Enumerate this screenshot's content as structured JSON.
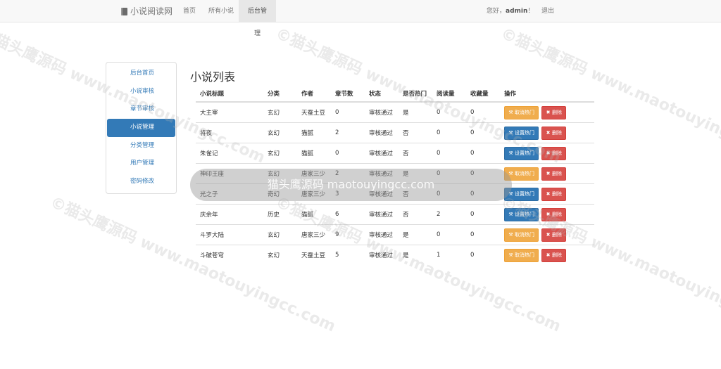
{
  "brand": {
    "title": "小说阅读网",
    "icon": "book-icon"
  },
  "nav": {
    "items": [
      {
        "label": "首页"
      },
      {
        "label": "所有小说"
      },
      {
        "label": "后台管理",
        "active": true
      }
    ],
    "greeting_prefix": "您好，",
    "username": "admin",
    "greeting_suffix": "！",
    "logout": "退出"
  },
  "sidebar": {
    "items": [
      {
        "label": "后台首页"
      },
      {
        "label": "小说审核"
      },
      {
        "label": "章节审核"
      },
      {
        "label": "小说管理",
        "active": true
      },
      {
        "label": "分类管理"
      },
      {
        "label": "用户管理"
      },
      {
        "label": "密码修改"
      }
    ]
  },
  "page": {
    "title": "小说列表"
  },
  "table": {
    "headers": [
      "小说标题",
      "分类",
      "作者",
      "章节数",
      "状态",
      "是否热门",
      "阅读量",
      "收藏量",
      "操作"
    ],
    "rows": [
      {
        "title": "大主宰",
        "category": "玄幻",
        "author": "天蚕土豆",
        "chapters": "0",
        "status": "审核通过",
        "hot": "是",
        "reads": "0",
        "favs": "0",
        "hot_action": "取消热门",
        "hot_state": "unhot"
      },
      {
        "title": "将夜",
        "category": "玄幻",
        "author": "猫腻",
        "chapters": "2",
        "status": "审核通过",
        "hot": "否",
        "reads": "0",
        "favs": "0",
        "hot_action": "设置热门",
        "hot_state": "hot"
      },
      {
        "title": "朱雀记",
        "category": "玄幻",
        "author": "猫腻",
        "chapters": "0",
        "status": "审核通过",
        "hot": "否",
        "reads": "0",
        "favs": "0",
        "hot_action": "设置热门",
        "hot_state": "hot"
      },
      {
        "title": "神印王座",
        "category": "玄幻",
        "author": "唐家三少",
        "chapters": "2",
        "status": "审核通过",
        "hot": "是",
        "reads": "0",
        "favs": "0",
        "hot_action": "取消热门",
        "hot_state": "unhot"
      },
      {
        "title": "光之子",
        "category": "奇幻",
        "author": "唐家三少",
        "chapters": "3",
        "status": "审核通过",
        "hot": "否",
        "reads": "0",
        "favs": "0",
        "hot_action": "设置热门",
        "hot_state": "hot"
      },
      {
        "title": "庆余年",
        "category": "历史",
        "author": "猫腻",
        "chapters": "6",
        "status": "审核通过",
        "hot": "否",
        "reads": "2",
        "favs": "0",
        "hot_action": "设置热门",
        "hot_state": "hot"
      },
      {
        "title": "斗罗大陆",
        "category": "玄幻",
        "author": "唐家三少",
        "chapters": "9",
        "status": "审核通过",
        "hot": "是",
        "reads": "0",
        "favs": "0",
        "hot_action": "取消热门",
        "hot_state": "unhot"
      },
      {
        "title": "斗破苍穹",
        "category": "玄幻",
        "author": "天蚕土豆",
        "chapters": "5",
        "status": "审核通过",
        "hot": "是",
        "reads": "1",
        "favs": "0",
        "hot_action": "取消热门",
        "hot_state": "unhot"
      }
    ],
    "delete_label": "删除"
  },
  "watermark": {
    "text": "©猫头鹰源码 www.maotouyingcc.com",
    "banner": "猫头鹰源码 maotouyingcc.com"
  }
}
